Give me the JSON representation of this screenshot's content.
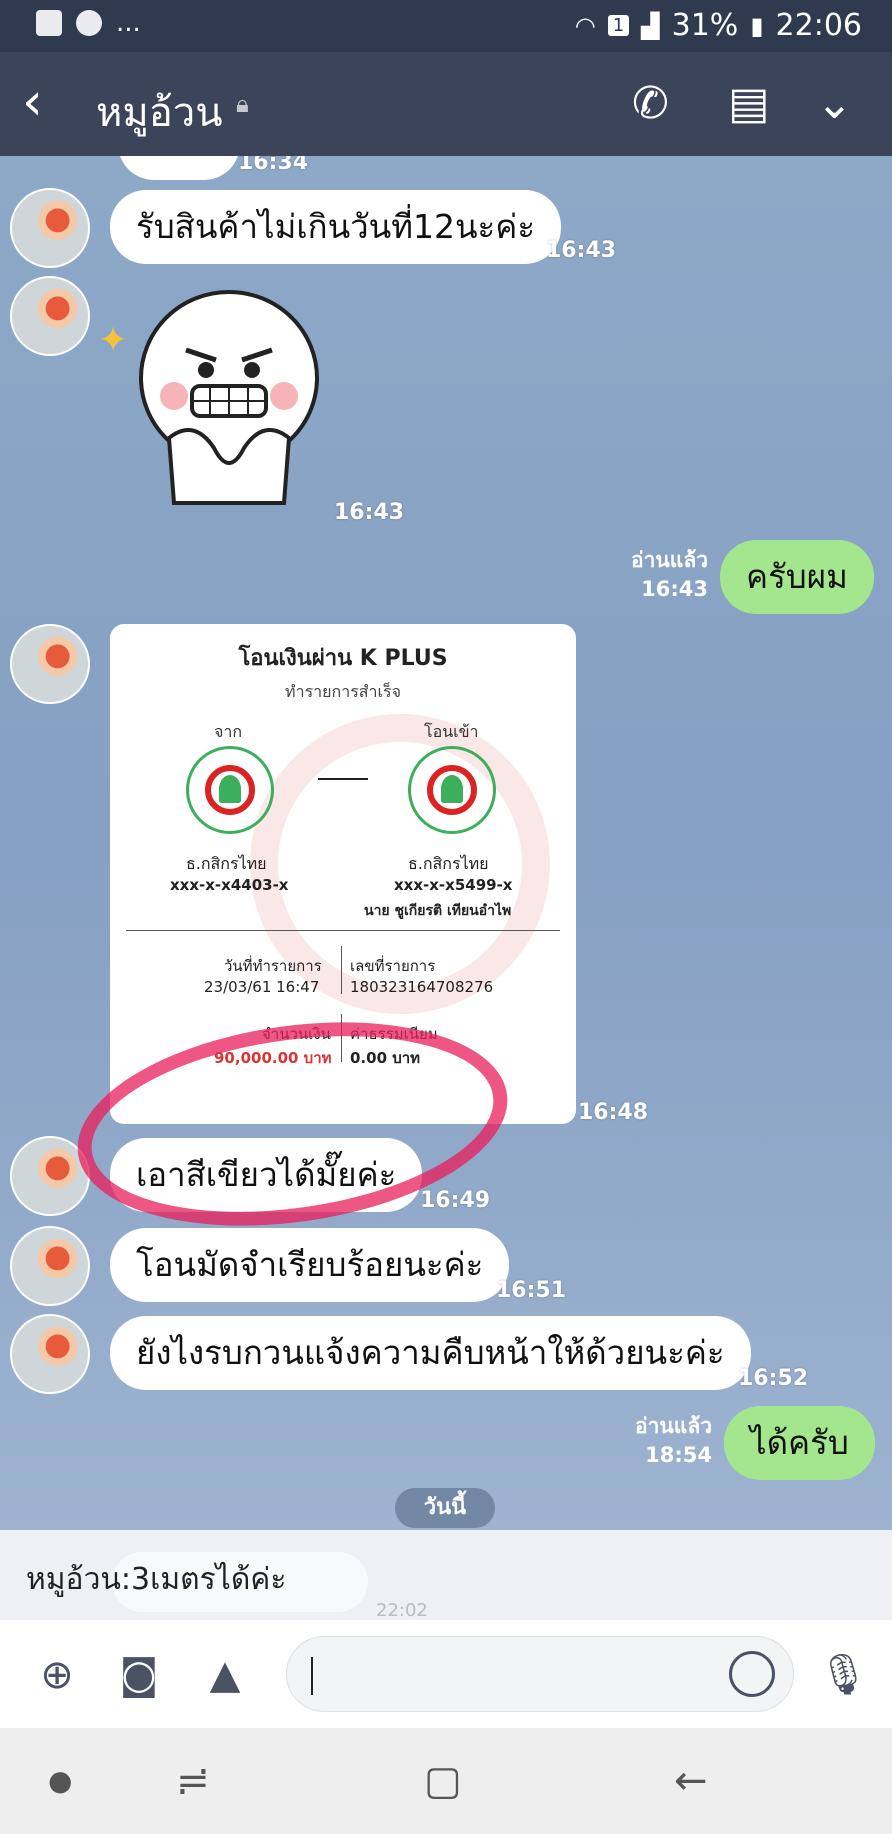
{
  "status_bar": {
    "signal_badge": "1",
    "battery": "31%",
    "clock": "22:06",
    "more": "..."
  },
  "header": {
    "back_icon": "chevron-left",
    "title": "หมูอ้วน",
    "lock_icon": "lock",
    "call_icon": "phone",
    "notes_icon": "note",
    "menu_icon": "chevron-down"
  },
  "messages": [
    {
      "side": "in",
      "time": "16:34",
      "text": ""
    },
    {
      "side": "in",
      "text": "รับสินค้าไม่เกินวันที่12นะค่ะ",
      "time": "16:43"
    },
    {
      "side": "in",
      "type": "sticker",
      "time": "16:43"
    },
    {
      "side": "out",
      "text": "ครับผม",
      "read": "อ่านแล้ว",
      "time": "16:43"
    },
    {
      "side": "in",
      "type": "image",
      "time": "16:48"
    },
    {
      "side": "in",
      "text": "เอาสีเขียวได้มั๊ยค่ะ",
      "time": "16:49"
    },
    {
      "side": "in",
      "text": "โอนมัดจำเรียบร้อยนะค่ะ",
      "time": "16:51"
    },
    {
      "side": "in",
      "text": "ยังไงรบกวนแจ้งความคืบหน้าให้ด้วยนะค่ะ",
      "time": "16:52"
    },
    {
      "side": "out",
      "text": "ได้ครับ",
      "read": "อ่านแล้ว",
      "time": "18:54"
    }
  ],
  "slip": {
    "title": "โอนเงินผ่าน K PLUS",
    "status": "ทำรายการสำเร็จ",
    "from_label": "จาก",
    "to_label": "โอนเข้า",
    "from_bank": "ธ.กสิกรไทย",
    "from_account": "xxx-x-x4403-x",
    "to_bank": "ธ.กสิกรไทย",
    "to_account": "xxx-x-x5499-x",
    "to_name": "นาย ชูเกียรติ เทียนอำไพ",
    "date_label": "วันที่ทำรายการ",
    "date_value": "23/03/61 16:47",
    "ref_label": "เลขที่รายการ",
    "ref_value": "180323164708276",
    "amount_label": "จำนวนเงิน",
    "amount_value": "90,000.00 บาท",
    "fee_label": "ค่าธรรมเนียม",
    "fee_value": "0.00 บาท"
  },
  "day_separator": "วันนี้",
  "preview": {
    "text": "หมูอ้วน:3เมตรได้ค่ะ",
    "ghost_time": "22:02"
  },
  "input_bar": {
    "add_icon": "plus-circle",
    "camera_icon": "camera",
    "image_icon": "image",
    "emoji_icon": "smile",
    "mic_icon": "microphone"
  },
  "colors": {
    "header_bg": "#3b4459",
    "incoming_bubble": "#ffffff",
    "outgoing_bubble": "#a3e68e",
    "chat_bg": "#8aa3c7",
    "annotation": "#e81e5a"
  }
}
